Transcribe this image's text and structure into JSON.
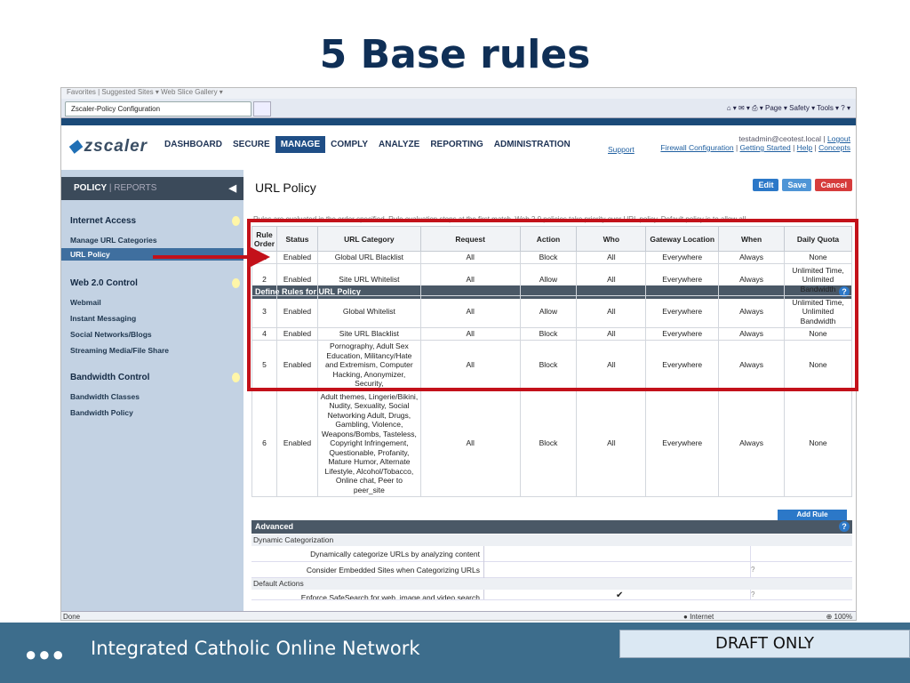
{
  "slide": {
    "title": "5 Base rules",
    "footer_text": "Integrated Catholic Online Network",
    "footer_dots": "●●●",
    "draft_label": "DRAFT ONLY"
  },
  "browser": {
    "favorites_bar": "Favorites  |  Suggested Sites ▾  Web Slice Gallery ▾",
    "tab_title": "Zscaler-Policy Configuration",
    "command_bar": "⌂ ▾  ✉ ▾  ⎙ ▾  Page ▾  Safety ▾  Tools ▾  ? ▾",
    "status_left": "Done",
    "status_zone": "Internet",
    "status_zoom": "100%"
  },
  "app": {
    "logo": "zscaler",
    "nav": [
      "DASHBOARD",
      "SECURE",
      "MANAGE",
      "COMPLY",
      "ANALYZE",
      "REPORTING",
      "ADMINISTRATION"
    ],
    "active_nav": "MANAGE",
    "account": "testadmin@ceotest.local",
    "logout": "Logout",
    "links": {
      "support": "Support",
      "firewall": "Firewall Configuration",
      "getting_started": "Getting Started",
      "help": "Help",
      "concepts": "Concepts"
    }
  },
  "sidebar": {
    "policy": "POLICY",
    "reports": "REPORTS",
    "sections": [
      {
        "title": "Internet Access",
        "items": [
          "Manage URL Categories",
          "URL Policy"
        ]
      },
      {
        "title": "Web 2.0 Control",
        "items": [
          "Webmail",
          "Instant Messaging",
          "Social Networks/Blogs",
          "Streaming Media/File Share"
        ]
      },
      {
        "title": "Bandwidth Control",
        "items": [
          "Bandwidth Classes",
          "Bandwidth Policy"
        ]
      }
    ],
    "selected": "URL Policy"
  },
  "main": {
    "title": "URL Policy",
    "buttons": {
      "edit": "Edit",
      "save": "Save",
      "cancel": "Cancel"
    },
    "define_header": "Define Rules for URL Policy",
    "note": "Rules are evaluated in the order specified. Rule evaluation stops at the first match. Web 2.0 policies take priority over URL policy. Default policy is to allow all.",
    "columns": [
      "Rule Order",
      "Status",
      "URL Category",
      "Request",
      "Action",
      "Who",
      "Gateway Location",
      "When",
      "Daily Quota"
    ],
    "rules": [
      [
        "1",
        "Enabled",
        "Global URL Blacklist",
        "All",
        "Block",
        "All",
        "Everywhere",
        "Always",
        "None"
      ],
      [
        "2",
        "Enabled",
        "Site URL Whitelist",
        "All",
        "Allow",
        "All",
        "Everywhere",
        "Always",
        "Unlimited Time, Unlimited Bandwidth"
      ],
      [
        "3",
        "Enabled",
        "Global Whitelist",
        "All",
        "Allow",
        "All",
        "Everywhere",
        "Always",
        "Unlimited Time, Unlimited Bandwidth"
      ],
      [
        "4",
        "Enabled",
        "Site URL Blacklist",
        "All",
        "Block",
        "All",
        "Everywhere",
        "Always",
        "None"
      ],
      [
        "5",
        "Enabled",
        "Pornography, Adult Sex Education, Militancy/Hate and Extremism, Computer Hacking, Anonymizer, Security,",
        "All",
        "Block",
        "All",
        "Everywhere",
        "Always",
        "None"
      ],
      [
        "6",
        "Enabled",
        "Adult themes, Lingerie/Bikini, Nudity, Sexuality, Social Networking Adult, Drugs, Gambling, Violence, Weapons/Bombs, Tasteless, Copyright Infringement, Questionable, Profanity, Mature Humor, Alternate Lifestyle, Alcohol/Tobacco, Online chat, Peer to peer_site",
        "All",
        "Block",
        "All",
        "Everywhere",
        "Always",
        "None"
      ]
    ],
    "add_rule": "Add Rule",
    "advanced": {
      "header": "Advanced",
      "dynamic_header": "Dynamic Categorization",
      "opt1": "Dynamically categorize URLs by analyzing content",
      "opt2": "Consider Embedded Sites when Categorizing URLs",
      "default_header": "Default Actions",
      "opt3": "Enforce SafeSearch for web, image and video search",
      "check": "✔"
    }
  },
  "colors": {
    "accent": "#c3111a",
    "title": "#0f2f56",
    "footer": "#3d6d8c"
  }
}
